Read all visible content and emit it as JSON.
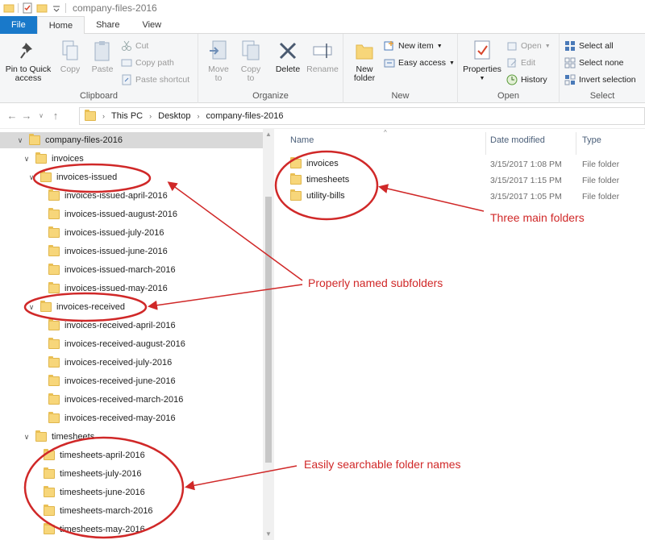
{
  "window": {
    "title": "company-files-2016"
  },
  "tabs": [
    {
      "label": "File"
    },
    {
      "label": "Home"
    },
    {
      "label": "Share"
    },
    {
      "label": "View"
    }
  ],
  "ribbon": {
    "clipboard": {
      "label": "Clipboard",
      "pin": "Pin to Quick access",
      "copy": "Copy",
      "paste": "Paste",
      "cut": "Cut",
      "copy_path": "Copy path",
      "paste_shortcut": "Paste shortcut"
    },
    "organize": {
      "label": "Organize",
      "move_to": "Move to",
      "copy_to": "Copy to",
      "delete": "Delete",
      "rename": "Rename"
    },
    "new": {
      "label": "New",
      "new_folder": "New folder",
      "new_item": "New item",
      "easy_access": "Easy access"
    },
    "open": {
      "label": "Open",
      "properties": "Properties",
      "open": "Open",
      "edit": "Edit",
      "history": "History"
    },
    "select": {
      "label": "Select",
      "select_all": "Select all",
      "select_none": "Select none",
      "invert": "Invert selection"
    }
  },
  "address": {
    "crumbs": [
      "This PC",
      "Desktop",
      "company-files-2016"
    ]
  },
  "tree": [
    {
      "label": "company-files-2016"
    },
    {
      "label": "invoices"
    },
    {
      "label": "invoices-issued"
    },
    {
      "label": "invoices-issued-april-2016"
    },
    {
      "label": "invoices-issued-august-2016"
    },
    {
      "label": "invoices-issued-july-2016"
    },
    {
      "label": "invoices-issued-june-2016"
    },
    {
      "label": "invoices-issued-march-2016"
    },
    {
      "label": "invoices-issued-may-2016"
    },
    {
      "label": "invoices-received"
    },
    {
      "label": "invoices-received-april-2016"
    },
    {
      "label": "invoices-received-august-2016"
    },
    {
      "label": "invoices-received-july-2016"
    },
    {
      "label": "invoices-received-june-2016"
    },
    {
      "label": "invoices-received-march-2016"
    },
    {
      "label": "invoices-received-may-2016"
    },
    {
      "label": "timesheets"
    },
    {
      "label": "timesheets-april-2016"
    },
    {
      "label": "timesheets-july-2016"
    },
    {
      "label": "timesheets-june-2016"
    },
    {
      "label": "timesheets-march-2016"
    },
    {
      "label": "timesheets-may-2016"
    }
  ],
  "files": {
    "headers": {
      "name": "Name",
      "date": "Date modified",
      "type": "Type"
    },
    "rows": [
      {
        "name": "invoices",
        "date": "3/15/2017 1:08 PM",
        "type": "File folder"
      },
      {
        "name": "timesheets",
        "date": "3/15/2017 1:15 PM",
        "type": "File folder"
      },
      {
        "name": "utility-bills",
        "date": "3/15/2017 1:05 PM",
        "type": "File folder"
      }
    ]
  },
  "annotations": {
    "main_folders": "Three main folders",
    "subfolders": "Properly named subfolders",
    "searchable": "Easily searchable folder names",
    "color": "#d02828"
  }
}
